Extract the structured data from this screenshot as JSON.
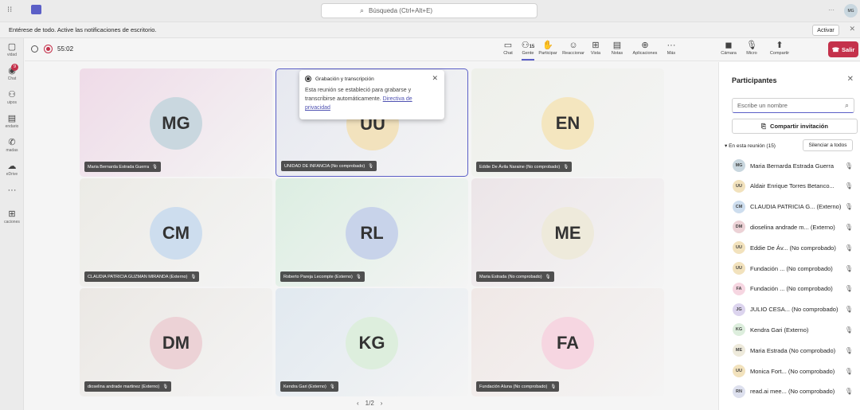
{
  "search": {
    "placeholder": "Búsqueda (Ctrl+Alt+E)"
  },
  "topbar": {
    "more": "···",
    "user_initials": "MG"
  },
  "notification": {
    "text": "Entérese de todo. Active las notificaciones de escritorio.",
    "button": "Activar",
    "close": "✕"
  },
  "rail": [
    {
      "label": "vidad",
      "icon": "▢"
    },
    {
      "label": "Chat",
      "icon": "◉",
      "badge": "9"
    },
    {
      "label": "uipos",
      "icon": "⚇"
    },
    {
      "label": "endario",
      "icon": "▤"
    },
    {
      "label": "madas",
      "icon": "✆"
    },
    {
      "label": "eDrive",
      "icon": "☁"
    },
    {
      "label": "",
      "icon": "···"
    },
    {
      "label": "caciones",
      "icon": "⊞"
    }
  ],
  "meeting": {
    "timer": "55:02"
  },
  "toolbar": [
    {
      "label": "Chat",
      "icon": "▭"
    },
    {
      "label": "Gente",
      "icon": "⚇",
      "count": "15"
    },
    {
      "label": "Participar",
      "icon": "✋"
    },
    {
      "label": "Reaccionar",
      "icon": "☺"
    },
    {
      "label": "Vista",
      "icon": "⊞"
    },
    {
      "label": "Notas",
      "icon": "▤"
    },
    {
      "label": "Aplicaciones",
      "icon": "⊕"
    },
    {
      "label": "Más",
      "icon": "···"
    },
    {
      "label": "Cámara",
      "icon": "◼"
    },
    {
      "label": "Micro",
      "icon": "🎙"
    },
    {
      "label": "Compartir",
      "icon": "⬆"
    }
  ],
  "leave_button": "Salir",
  "tiles": [
    {
      "initials": "MG",
      "name": "Maria Bernarda Estrada Guerra",
      "avatar": "#c9d7df",
      "bg": "#efdbe8"
    },
    {
      "initials": "UU",
      "name": "UNIDAD DE INFANCIA (No comprobado)",
      "avatar": "#f2e2bd",
      "bg": "#e6e8f0"
    },
    {
      "initials": "EN",
      "name": "Eddie De Ávila Naraine (No comprobado)",
      "avatar": "#f4e6bf",
      "bg": "#eef0ea"
    },
    {
      "initials": "CM",
      "name": "CLAUDIA PATRICIA GUZMAN MIRANDA (Externo)",
      "avatar": "#cdddee",
      "bg": "#ecebe6"
    },
    {
      "initials": "RL",
      "name": "Roberto Pareja Lecompte (Externo)",
      "avatar": "#c8d3ea",
      "bg": "#dceee2"
    },
    {
      "initials": "ME",
      "name": "Maria Estrada (No comprobado)",
      "avatar": "#eeeadb",
      "bg": "#ece5e8"
    },
    {
      "initials": "DM",
      "name": "dioselina andrade martinez (Externo)",
      "avatar": "#ecd2d6",
      "bg": "#ebe8e4"
    },
    {
      "initials": "KG",
      "name": "Kendra Gari (Externo)",
      "avatar": "#ddeedd",
      "bg": "#e1e9f0"
    },
    {
      "initials": "FA",
      "name": "Fundación Aluna (No comprobado)",
      "avatar": "#f6d6e1",
      "bg": "#f0e8e6"
    }
  ],
  "pagination": "1/2",
  "popup": {
    "title": "Grabación y transcripción",
    "body": "Esta reunión se estableció para grabarse y transcribirse automáticamente.",
    "link": "Directiva de privacidad"
  },
  "panel": {
    "title": "Participantes",
    "search_placeholder": "Escribe un nombre",
    "invite": "Compartir invitación",
    "section": "En esta reunión (15)",
    "mute_all": "Silenciar a todos",
    "people": [
      {
        "initials": "MG",
        "name": "Maria Bernarda Estrada Guerra",
        "color": "#c9d7df"
      },
      {
        "initials": "UU",
        "name": "Aldair Enrique Torres Betanco...",
        "color": "#f2e2bd"
      },
      {
        "initials": "CM",
        "name": "CLAUDIA PATRICIA G... (Externo)",
        "color": "#cdddee"
      },
      {
        "initials": "DM",
        "name": "dioselina andrade m... (Externo)",
        "color": "#ecd2d6"
      },
      {
        "initials": "UU",
        "name": "Eddie De Áv... (No comprobado)",
        "color": "#f2e2bd"
      },
      {
        "initials": "UU",
        "name": "Fundación ... (No comprobado)",
        "color": "#f2e2bd"
      },
      {
        "initials": "FA",
        "name": "Fundación ... (No comprobado)",
        "color": "#f6d6e1"
      },
      {
        "initials": "JG",
        "name": "JULIO CESA... (No comprobado)",
        "color": "#dcd4ee"
      },
      {
        "initials": "KG",
        "name": "Kendra Gari (Externo)",
        "color": "#ddeedd"
      },
      {
        "initials": "ME",
        "name": "Maria Estrada (No comprobado)",
        "color": "#eeeadb"
      },
      {
        "initials": "UU",
        "name": "Monica Fort... (No comprobado)",
        "color": "#f2e2bd"
      },
      {
        "initials": "RN",
        "name": "read.ai mee... (No comprobado)",
        "color": "#dde0ee"
      }
    ]
  }
}
